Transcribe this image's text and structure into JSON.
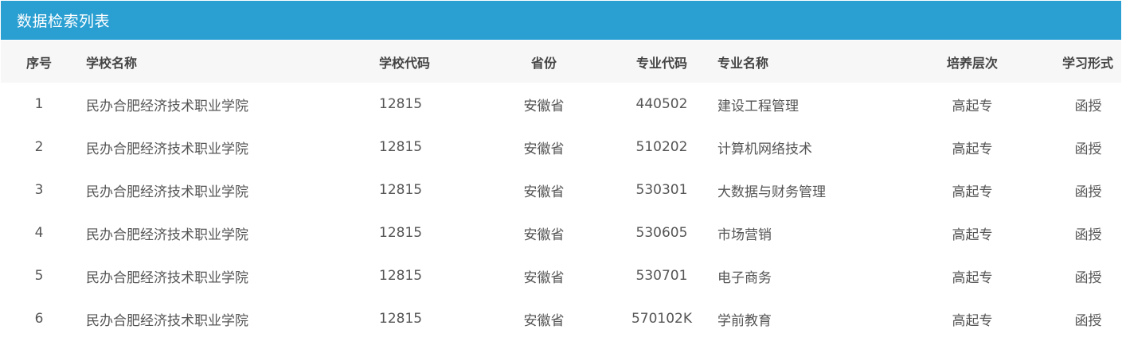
{
  "panel": {
    "title": "数据检索列表"
  },
  "table": {
    "headers": {
      "seq": "序号",
      "school_name": "学校名称",
      "school_code": "学校代码",
      "province": "省份",
      "major_code": "专业代码",
      "major_name": "专业名称",
      "level": "培养层次",
      "study_form": "学习形式"
    },
    "rows": [
      {
        "seq": "1",
        "school_name": "民办合肥经济技术职业学院",
        "school_code": "12815",
        "province": "安徽省",
        "major_code": "440502",
        "major_name": "建设工程管理",
        "level": "高起专",
        "study_form": "函授"
      },
      {
        "seq": "2",
        "school_name": "民办合肥经济技术职业学院",
        "school_code": "12815",
        "province": "安徽省",
        "major_code": "510202",
        "major_name": "计算机网络技术",
        "level": "高起专",
        "study_form": "函授"
      },
      {
        "seq": "3",
        "school_name": "民办合肥经济技术职业学院",
        "school_code": "12815",
        "province": "安徽省",
        "major_code": "530301",
        "major_name": "大数据与财务管理",
        "level": "高起专",
        "study_form": "函授"
      },
      {
        "seq": "4",
        "school_name": "民办合肥经济技术职业学院",
        "school_code": "12815",
        "province": "安徽省",
        "major_code": "530605",
        "major_name": "市场营销",
        "level": "高起专",
        "study_form": "函授"
      },
      {
        "seq": "5",
        "school_name": "民办合肥经济技术职业学院",
        "school_code": "12815",
        "province": "安徽省",
        "major_code": "530701",
        "major_name": "电子商务",
        "level": "高起专",
        "study_form": "函授"
      },
      {
        "seq": "6",
        "school_name": "民办合肥经济技术职业学院",
        "school_code": "12815",
        "province": "安徽省",
        "major_code": "570102K",
        "major_name": "学前教育",
        "level": "高起专",
        "study_form": "函授"
      }
    ]
  }
}
